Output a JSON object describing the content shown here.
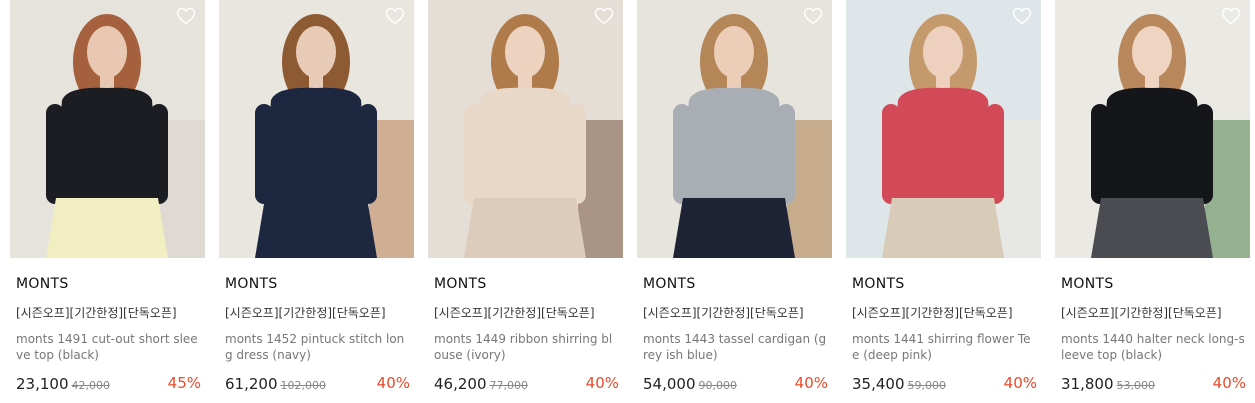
{
  "products": [
    {
      "brand": "MONTS",
      "tags": "[시즌오프][기간한정][단독오픈]",
      "name": "monts 1491 cut-out short sleeve top (black)",
      "price": "23,100",
      "original_price": "42,000",
      "discount": "45%",
      "photo": {
        "bg": "#e6e2dc",
        "top": "#1b1d22",
        "bottom": "#f1efc2",
        "hair": "#a5603e",
        "skin": "#e8c8b2",
        "accent": "#d5d0c8"
      }
    },
    {
      "brand": "MONTS",
      "tags": "[시즌오프][기간한정][단독오픈]",
      "name": "monts 1452 pintuck stitch long dress (navy)",
      "price": "61,200",
      "original_price": "102,000",
      "discount": "40%",
      "photo": {
        "bg": "#e9e5df",
        "top": "#1d2740",
        "bottom": "#1d2740",
        "hair": "#8e5a33",
        "skin": "#e7cbb6",
        "accent": "#b5774a"
      }
    },
    {
      "brand": "MONTS",
      "tags": "[시즌오프][기간한정][단독오픈]",
      "name": "monts 1449 ribbon shirring blouse (ivory)",
      "price": "46,200",
      "original_price": "77,000",
      "discount": "40%",
      "photo": {
        "bg": "#e4ded6",
        "top": "#e8d8c8",
        "bottom": "#ddccbb",
        "hair": "#b07b4b",
        "skin": "#edd2bf",
        "accent": "#6f4a33"
      }
    },
    {
      "brand": "MONTS",
      "tags": "[시즌오프][기간한정][단독오픈]",
      "name": "monts 1443 tassel cardigan (grey ish blue)",
      "price": "54,000",
      "original_price": "90,000",
      "discount": "40%",
      "photo": {
        "bg": "#e7e3dd",
        "top": "#a9adb4",
        "bottom": "#1e2336",
        "hair": "#b48658",
        "skin": "#ebcdb8",
        "accent": "#a8753f"
      }
    },
    {
      "brand": "MONTS",
      "tags": "[시즌오프][기간한정][단독오픈]",
      "name": "monts 1441 shirring flower Tee (deep pink)",
      "price": "35,400",
      "original_price": "59,000",
      "discount": "40%",
      "photo": {
        "bg": "#dfe6ea",
        "top": "#d24a57",
        "bottom": "#d8cbb8",
        "hair": "#c49a6c",
        "skin": "#edd0bd",
        "accent": "#efe9dd"
      }
    },
    {
      "brand": "MONTS",
      "tags": "[시즌오프][기간한정][단독오픈]",
      "name": "monts 1440 halter neck long-sleeve top (black)",
      "price": "31,800",
      "original_price": "53,000",
      "discount": "40%",
      "photo": {
        "bg": "#ebe9e4",
        "top": "#15161a",
        "bottom": "#4b4c52",
        "hair": "#b8875c",
        "skin": "#efd4c2",
        "accent": "#3f7a3a"
      }
    }
  ],
  "colors": {
    "discount": "#e84a2a",
    "price": "#222222",
    "muted": "#777777"
  },
  "icons": {
    "wishlist": "heart-outline-icon"
  }
}
